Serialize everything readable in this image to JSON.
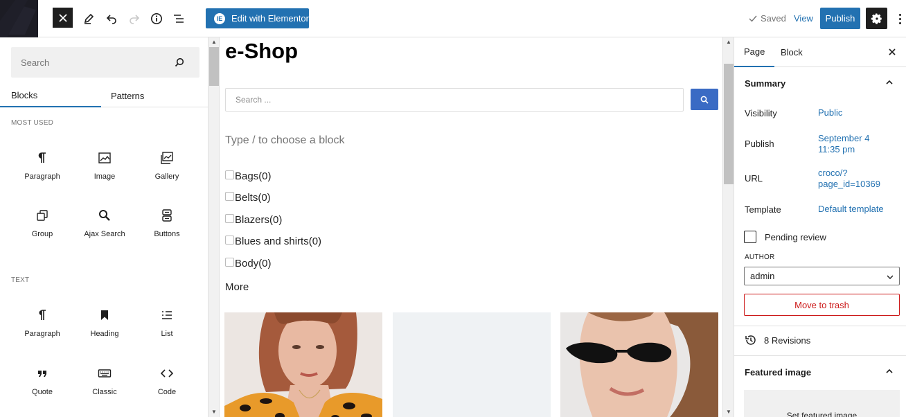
{
  "topbar": {
    "edit_elementor": "Edit with Elementor",
    "elementor_icon": "IE",
    "saved": "Saved",
    "view": "View",
    "publish": "Publish"
  },
  "inserter": {
    "search_placeholder": "Search",
    "tabs": [
      "Blocks",
      "Patterns"
    ],
    "categories": [
      {
        "name": "MOST USED",
        "blocks": [
          "Paragraph",
          "Image",
          "Gallery",
          "Group",
          "Ajax Search",
          "Buttons"
        ]
      },
      {
        "name": "TEXT",
        "blocks": [
          "Paragraph",
          "Heading",
          "List",
          "Quote",
          "Classic",
          "Code"
        ]
      }
    ]
  },
  "canvas": {
    "title": "e-Shop",
    "search_placeholder": "Search ...",
    "type_hint": "Type / to choose a block",
    "categories": [
      "Bags(0)",
      "Belts(0)",
      "Blazers(0)",
      "Blues and shirts(0)",
      "Body(0)"
    ],
    "more": "More"
  },
  "sidebar": {
    "tabs": [
      "Page",
      "Block"
    ],
    "summary_title": "Summary",
    "visibility_label": "Visibility",
    "visibility_value": "Public",
    "publish_label": "Publish",
    "publish_value_line1": "September 4",
    "publish_value_line2": "11:35 pm",
    "url_label": "URL",
    "url_value_line1": "croco/?",
    "url_value_line2": "page_id=10369",
    "template_label": "Template",
    "template_value": "Default template",
    "pending_review": "Pending review",
    "author_label": "AUTHOR",
    "author_value": "admin",
    "move_to_trash": "Move to trash",
    "revisions": "8 Revisions",
    "featured_image_title": "Featured image",
    "featured_image_button": "Set featured image"
  },
  "colors": {
    "accent": "#2271b1",
    "danger": "#cc1818",
    "search_button": "#3a6bc4",
    "dark": "#1e1e1e"
  }
}
